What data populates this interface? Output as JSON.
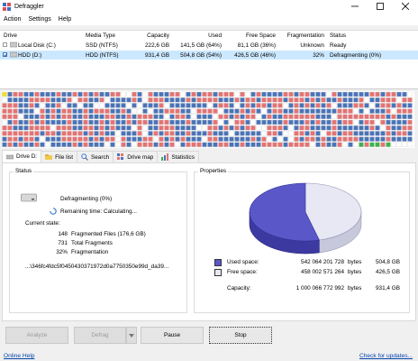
{
  "window": {
    "title": "Defraggler"
  },
  "menu": [
    "Action",
    "Settings",
    "Help"
  ],
  "drive_table": {
    "columns": [
      "Drive",
      "Media Type",
      "Capacity",
      "Used",
      "Free Space",
      "Fragmentation",
      "Status"
    ],
    "rows": [
      {
        "drive": "Local Disk (C:)",
        "media": "SSD (NTFS)",
        "capacity": "222,6 GB",
        "used": "141,5 GB (64%)",
        "free": "81,1 GB (36%)",
        "frag": "Unknown",
        "status": "Ready",
        "checked": false
      },
      {
        "drive": "HDD (D:)",
        "media": "HDD (NTFS)",
        "capacity": "931,4 GB",
        "used": "504,8 GB (54%)",
        "free": "426,5 GB (46%)",
        "frag": "32%",
        "status": "Defragmenting (0%)",
        "checked": true
      }
    ]
  },
  "colors": {
    "fragmented": "#e57373",
    "used": "#4a74b8",
    "free": "#ffffff",
    "mft": "#f0e020",
    "defragged": "#3cb34a",
    "used_pie": "#5a58c8",
    "free_pie": "#e8e8f4"
  },
  "tabs": [
    "Drive D:",
    "File list",
    "Search",
    "Drive map",
    "Statistics"
  ],
  "status_group": {
    "label": "Status",
    "state": "Defragmenting (0%)",
    "remaining": "Remaining time: Calculating...",
    "current_state_label": "Current state:",
    "fragmented_files_count": "148",
    "fragmented_files_label": "Fragmented Files (176,6 GB)",
    "total_fragments_count": "731",
    "total_fragments_label": "Total Fragments",
    "fragmentation_pct": "32%",
    "fragmentation_label": "Fragmentation",
    "current_file": "...\\346fc4fdc5f0450430371972d0a7750350e99d_da39..."
  },
  "properties_group": {
    "label": "Properties",
    "used_space_label": "Used space:",
    "used_space_bytes": "542 064 201 728",
    "used_space_unit": "bytes",
    "used_space_gb": "504,8 GB",
    "free_space_label": "Free space:",
    "free_space_bytes": "458 002 571 264",
    "free_space_unit": "bytes",
    "free_space_gb": "426,5 GB",
    "capacity_label": "Capacity:",
    "capacity_bytes": "1 000 066 772 992",
    "capacity_unit": "bytes",
    "capacity_gb": "931,4 GB",
    "used_fraction": 0.54
  },
  "buttons": {
    "analyze": "Analyze",
    "defrag": "Defrag",
    "pause": "Pause",
    "stop": "Stop"
  },
  "footer": {
    "help": "Online Help",
    "updates": "Check for updates..."
  }
}
